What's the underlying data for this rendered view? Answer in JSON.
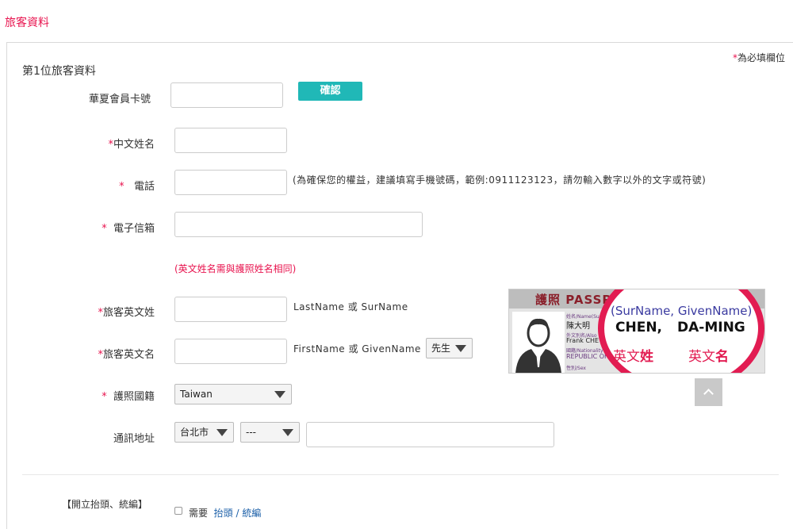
{
  "page": {
    "title": "旅客資料"
  },
  "required_note": {
    "star": "*",
    "text": "為必填欄位"
  },
  "section": {
    "title": "第1位旅客資料"
  },
  "member": {
    "label": "華夏會員卡號",
    "value": "",
    "confirm_label": "確認"
  },
  "chinese_name": {
    "star": "*",
    "label": "中文姓名",
    "value": ""
  },
  "phone": {
    "star": "*",
    "label": "電話",
    "value": "",
    "hint": "(為確保您的權益，建議填寫手機號碼，範例:0911123123，請勿輸入數字以外的文字或符號)"
  },
  "email": {
    "star": "*",
    "label": "電子信箱",
    "value": ""
  },
  "english_warning": "(英文姓名需與護照姓名相同)",
  "surname": {
    "star": "*",
    "label": "旅客英文姓",
    "value": "",
    "hint": "LastName 或 SurName"
  },
  "given_name": {
    "star": "*",
    "label": "旅客英文名",
    "value": "",
    "hint": "FirstName 或 GivenName",
    "title_select": "先生"
  },
  "nationality": {
    "star": "*",
    "label": "護照國籍",
    "selected": "Taiwan"
  },
  "address": {
    "label": "通訊地址",
    "city": "台北市",
    "district": "---",
    "value": ""
  },
  "passport_sample": {
    "header": "護照 PASSP",
    "field_name": "姓名/Name(Su",
    "name_value": "陳大明",
    "field_alias": "外文別名/Also",
    "alias_value": "Frank  CHE",
    "field_nationality": "國籍/Nationality",
    "nationality_value": "REPUBLIC OF",
    "field_sex": "性別/Sex",
    "callout_line1": "(SurName,  GivenName)",
    "callout_surname": "CHEN,",
    "callout_given": "DA-MING",
    "callout_surname_zh_a": "英文",
    "callout_surname_zh_b": "姓",
    "callout_given_zh_a": "英文",
    "callout_given_zh_b": "名"
  },
  "invoice": {
    "title": "【開立抬頭、統編】",
    "need_label": "需要",
    "link_a": "抬頭",
    "sep": " / ",
    "link_b": "統編"
  },
  "colors": {
    "accent": "#e8134e",
    "confirm": "#20b8b7",
    "link": "#1b5fa8"
  }
}
